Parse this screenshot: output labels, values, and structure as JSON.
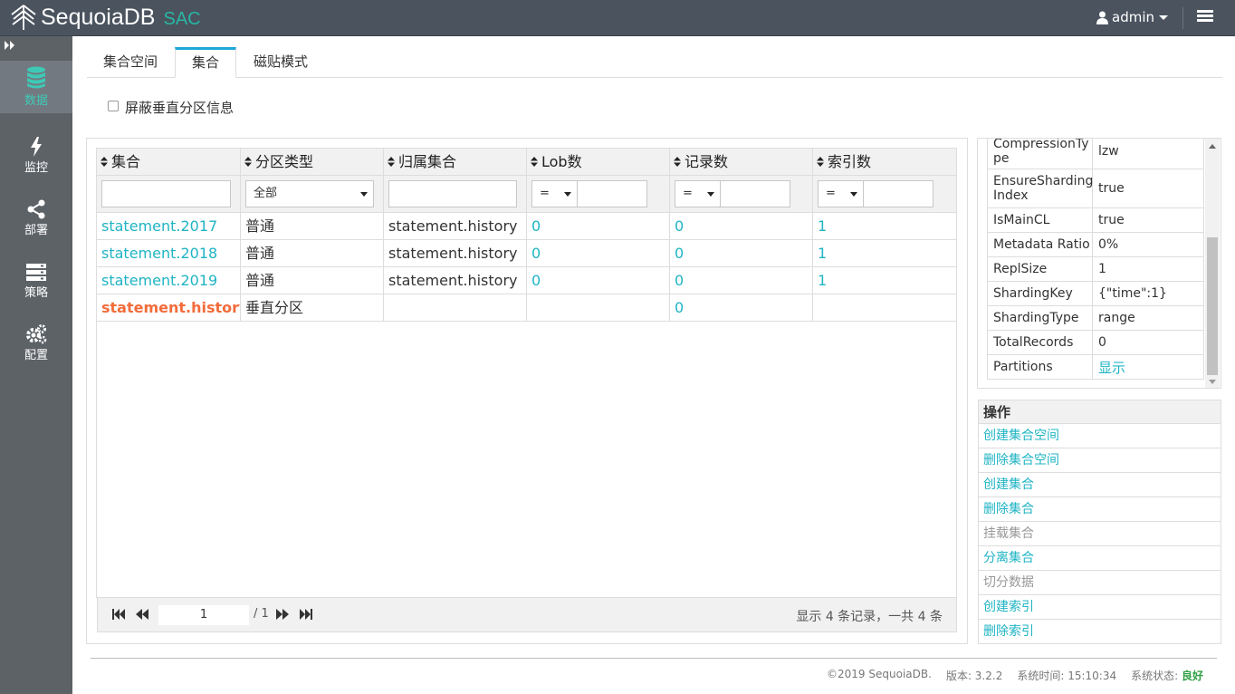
{
  "header": {
    "brand": "SequoiaDB",
    "brand_sub": "SAC",
    "user": "admin"
  },
  "sidebar": {
    "items": [
      {
        "label": "数据",
        "icon": "database-icon",
        "active": true
      },
      {
        "label": "监控",
        "icon": "lightning-icon"
      },
      {
        "label": "部署",
        "icon": "share-icon"
      },
      {
        "label": "策略",
        "icon": "server-icon"
      },
      {
        "label": "配置",
        "icon": "gears-icon"
      }
    ]
  },
  "tabs": [
    {
      "label": "集合空间"
    },
    {
      "label": "集合",
      "active": true
    },
    {
      "label": "磁贴模式"
    }
  ],
  "options": {
    "hide_vertical_partition": "屏蔽垂直分区信息",
    "checked": false
  },
  "grid": {
    "columns": [
      "集合",
      "分区类型",
      "归属集合",
      "Lob数",
      "记录数",
      "索引数"
    ],
    "filters": {
      "type_select": "全部",
      "op": "="
    },
    "rows": [
      {
        "name": "statement.2017",
        "type": "普通",
        "main": "statement.history",
        "lob": "0",
        "records": "0",
        "indexes": "1"
      },
      {
        "name": "statement.2018",
        "type": "普通",
        "main": "statement.history",
        "lob": "0",
        "records": "0",
        "indexes": "1"
      },
      {
        "name": "statement.2019",
        "type": "普通",
        "main": "statement.history",
        "lob": "0",
        "records": "0",
        "indexes": "1"
      },
      {
        "name": "statement.history",
        "type": "垂直分区",
        "main": "",
        "lob": "",
        "records": "0",
        "indexes": ""
      }
    ],
    "pager": {
      "page": "1",
      "total": "/ 1",
      "info": "显示 4 条记录，一共 4 条"
    }
  },
  "detail": {
    "rows": [
      {
        "key": "CompressionType",
        "value": "lzw"
      },
      {
        "key": "EnsureSharding Index",
        "value": "true"
      },
      {
        "key": "IsMainCL",
        "value": "true"
      },
      {
        "key": "Metadata Ratio",
        "value": "0%"
      },
      {
        "key": "ReplSize",
        "value": "1"
      },
      {
        "key": "ShardingKey",
        "value": "{\"time\":1}"
      },
      {
        "key": "ShardingType",
        "value": "range"
      },
      {
        "key": "TotalRecords",
        "value": "0"
      },
      {
        "key": "Partitions",
        "value": "显示"
      }
    ]
  },
  "operations": {
    "title": "操作",
    "items": [
      {
        "label": "创建集合空间",
        "enabled": true
      },
      {
        "label": "删除集合空间",
        "enabled": true
      },
      {
        "label": "创建集合",
        "enabled": true
      },
      {
        "label": "删除集合",
        "enabled": true
      },
      {
        "label": "挂载集合",
        "enabled": false
      },
      {
        "label": "分离集合",
        "enabled": true
      },
      {
        "label": "切分数据",
        "enabled": false
      },
      {
        "label": "创建索引",
        "enabled": true
      },
      {
        "label": "删除索引",
        "enabled": true
      }
    ]
  },
  "footer": {
    "copyright": "©2019 SequoiaDB.",
    "version": "版本: 3.2.2",
    "time": "系统时间: 15:10:34",
    "status_label": "系统状态:",
    "status_value": "良好"
  },
  "colors": {
    "accent": "#1fb4c4",
    "highlight": "#f26c3b",
    "brand_green": "#28b7a4",
    "topbar": "#4a535e",
    "sidebar": "#5d6267"
  }
}
